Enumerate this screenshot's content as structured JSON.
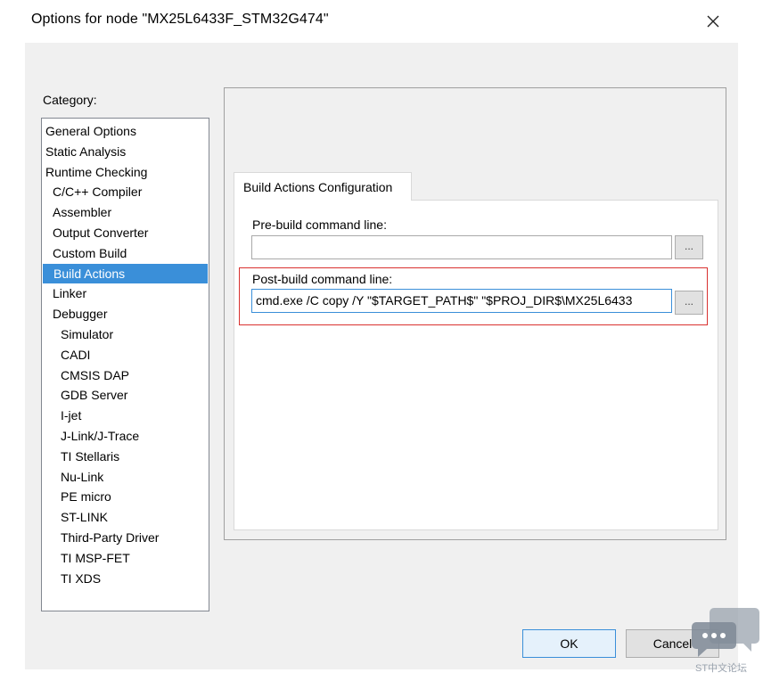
{
  "window": {
    "title": "Options for node \"MX25L6433F_STM32G474\"",
    "close_glyph": "✕"
  },
  "category": {
    "label": "Category:",
    "items": [
      {
        "label": "General Options",
        "level": 0
      },
      {
        "label": "Static Analysis",
        "level": 0
      },
      {
        "label": "Runtime Checking",
        "level": 0
      },
      {
        "label": "C/C++ Compiler",
        "level": 1
      },
      {
        "label": "Assembler",
        "level": 1
      },
      {
        "label": "Output Converter",
        "level": 1
      },
      {
        "label": "Custom Build",
        "level": 1
      },
      {
        "label": "Build Actions",
        "level": 1,
        "selected": true
      },
      {
        "label": "Linker",
        "level": 1
      },
      {
        "label": "Debugger",
        "level": 1
      },
      {
        "label": "Simulator",
        "level": 2
      },
      {
        "label": "CADI",
        "level": 2
      },
      {
        "label": "CMSIS DAP",
        "level": 2
      },
      {
        "label": "GDB Server",
        "level": 2
      },
      {
        "label": "I-jet",
        "level": 2
      },
      {
        "label": "J-Link/J-Trace",
        "level": 2
      },
      {
        "label": "TI Stellaris",
        "level": 2
      },
      {
        "label": "Nu-Link",
        "level": 2
      },
      {
        "label": "PE micro",
        "level": 2
      },
      {
        "label": "ST-LINK",
        "level": 2
      },
      {
        "label": "Third-Party Driver",
        "level": 2
      },
      {
        "label": "TI MSP-FET",
        "level": 2
      },
      {
        "label": "TI XDS",
        "level": 2
      }
    ]
  },
  "tab": {
    "label": "Build Actions Configuration"
  },
  "pre_build": {
    "label": "Pre-build command line:",
    "value": "",
    "browse_label": "..."
  },
  "post_build": {
    "label": "Post-build command line:",
    "value": "cmd.exe /C copy /Y \"$TARGET_PATH$\" \"$PROJ_DIR$\\MX25L6433",
    "browse_label": "..."
  },
  "buttons": {
    "ok": "OK",
    "cancel": "Cancel"
  },
  "watermark": {
    "text": "ST中文论坛"
  },
  "colors": {
    "selection": "#3a8fd9",
    "highlight_border": "#d9312f",
    "dialog_bg": "#f0f0f0"
  }
}
